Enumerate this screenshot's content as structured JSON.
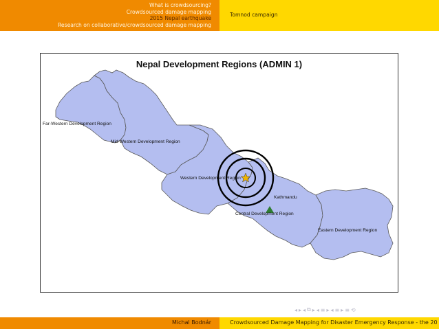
{
  "header": {
    "sections": [
      {
        "label": "What is crowdsourcing?",
        "active": false
      },
      {
        "label": "Crowdsourced damage mapping",
        "active": false
      },
      {
        "label": "2015 Nepal earthquake",
        "active": true
      },
      {
        "label": "Research on collaborative/crowdsourced damage mapping",
        "active": false
      }
    ],
    "subsection": "Tomnod campaign"
  },
  "map": {
    "title": "Nepal Development Regions (ADMIN 1)",
    "regions": [
      "Far-Western Development Region",
      "Mid-Western Development Region",
      "Western Development Region",
      "Central Development Region",
      "Eastern Development Region"
    ],
    "city_label": "Kathmandu",
    "fill_color": "#b4bef0",
    "border_color": "#5a5a5a"
  },
  "footer": {
    "author": "Michal Bodnár",
    "title_and_page": "Crowdsourced Damage Mapping for Disaster Emergency Response - the 20"
  },
  "colors": {
    "orange": "#f08a00",
    "yellow": "#ffd800",
    "epicenter_star": "#f0b400",
    "city_marker": "#2e7d32"
  },
  "beamer_nav_icons": [
    "prev-slide",
    "next-slide",
    "prev-frame",
    "next-frame",
    "prev-subsection",
    "next-subsection",
    "prev-section",
    "next-section",
    "align",
    "search"
  ]
}
